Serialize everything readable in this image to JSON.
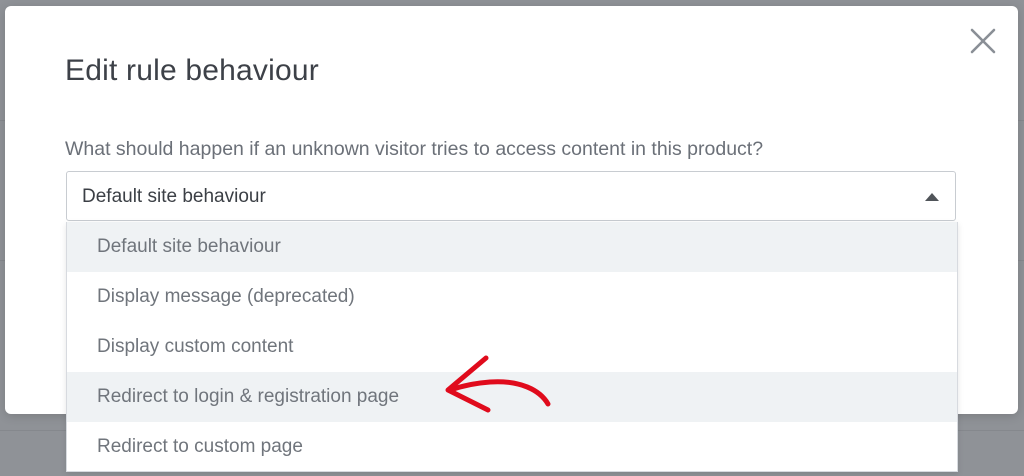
{
  "dialog": {
    "title": "Edit rule behaviour",
    "close_icon": "close-icon",
    "question": "What should happen if an unknown visitor tries to access content in this product?"
  },
  "select": {
    "selected_value": "Default site behaviour",
    "caret_icon": "caret-up-icon",
    "options": [
      {
        "label": "Default site behaviour",
        "highlighted": true
      },
      {
        "label": "Display message (deprecated)",
        "highlighted": false
      },
      {
        "label": "Display custom content",
        "highlighted": false
      },
      {
        "label": "Redirect to login & registration page",
        "highlighted": true
      },
      {
        "label": "Redirect to custom page",
        "highlighted": false
      }
    ]
  },
  "annotation": {
    "arrow_color": "#e00b1c",
    "points_to": "Redirect to login & registration page"
  },
  "colors": {
    "overlay": "#9a9da3",
    "highlight_row": "#eff2f4",
    "title_text": "#3d4148"
  }
}
